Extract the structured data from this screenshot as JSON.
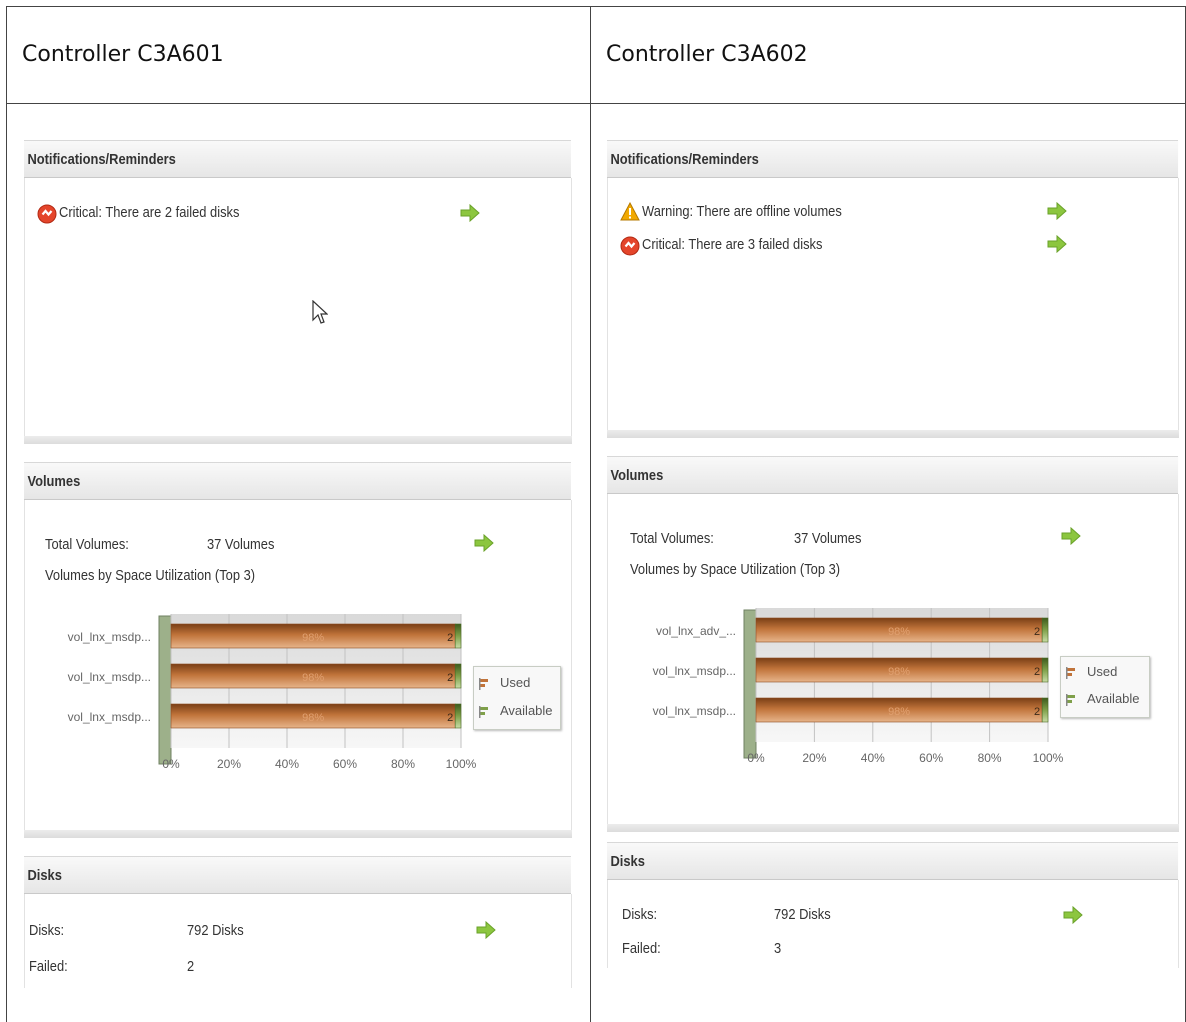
{
  "columns": [
    {
      "title": "Controller C3A601",
      "notifications": {
        "heading": "Notifications/Reminders",
        "items": [
          {
            "type": "critical",
            "icon": "critical-icon",
            "text": "Critical: There are 2 failed disks"
          }
        ]
      },
      "volumes": {
        "heading": "Volumes",
        "total_label": "Total Volumes:",
        "total_value": "37 Volumes",
        "subtitle": "Volumes by Space Utilization (Top 3)"
      },
      "disks": {
        "heading": "Disks",
        "disks_label": "Disks:",
        "disks_value": "792 Disks",
        "failed_label": "Failed:",
        "failed_value": "2"
      }
    },
    {
      "title": "Controller C3A602",
      "notifications": {
        "heading": "Notifications/Reminders",
        "items": [
          {
            "type": "warning",
            "icon": "warning-icon",
            "text": "Warning: There are offline volumes"
          },
          {
            "type": "critical",
            "icon": "critical-icon",
            "text": "Critical: There are 3 failed disks"
          }
        ]
      },
      "volumes": {
        "heading": "Volumes",
        "total_label": "Total Volumes:",
        "total_value": "37 Volumes",
        "subtitle": "Volumes by Space Utilization (Top 3)"
      },
      "disks": {
        "heading": "Disks",
        "disks_label": "Disks:",
        "disks_value": "792 Disks",
        "failed_label": "Failed:",
        "failed_value": "3"
      }
    }
  ],
  "chart_data": [
    {
      "type": "bar",
      "orientation": "horizontal",
      "stacked": true,
      "categories": [
        "vol_lnx_msdp...",
        "vol_lnx_msdp...",
        "vol_lnx_msdp..."
      ],
      "series": [
        {
          "name": "Used",
          "values": [
            98,
            98,
            98
          ],
          "labels": [
            "98%",
            "98%",
            "98%"
          ],
          "color": "#c0733a"
        },
        {
          "name": "Available",
          "values": [
            2,
            2,
            2
          ],
          "labels": [
            "2",
            "2",
            "2"
          ],
          "color": "#7fa04a"
        }
      ],
      "xticks": [
        "0%",
        "20%",
        "40%",
        "60%",
        "80%",
        "100%"
      ],
      "xlim": [
        0,
        100
      ],
      "legend": "right"
    },
    {
      "type": "bar",
      "orientation": "horizontal",
      "stacked": true,
      "categories": [
        "vol_lnx_adv_...",
        "vol_lnx_msdp...",
        "vol_lnx_msdp..."
      ],
      "series": [
        {
          "name": "Used",
          "values": [
            98,
            98,
            98
          ],
          "labels": [
            "98%",
            "98%",
            "98%"
          ],
          "color": "#c0733a"
        },
        {
          "name": "Available",
          "values": [
            2,
            2,
            2
          ],
          "labels": [
            "2",
            "2",
            "2"
          ],
          "color": "#7fa04a"
        }
      ],
      "xticks": [
        "0%",
        "20%",
        "40%",
        "60%",
        "80%",
        "100%"
      ],
      "xlim": [
        0,
        100
      ],
      "legend": "right"
    }
  ],
  "colors": {
    "used": "#c0733a",
    "available": "#7fa04a",
    "arrow": "#8cc63f",
    "critical": "#e4452b",
    "warning": "#f2a900"
  }
}
